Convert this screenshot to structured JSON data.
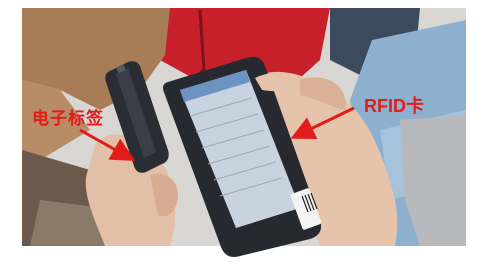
{
  "labels": {
    "tag_label": "电子标签",
    "rfid_label": "RFID卡"
  },
  "colors": {
    "annotation": "#e21b1b",
    "device_body": "#262a30",
    "screen": "#c9d3e0",
    "tag_body": "#2a2d33"
  },
  "icons": {
    "tag_pointer": "arrow-icon",
    "rfid_pointer": "arrow-icon"
  }
}
